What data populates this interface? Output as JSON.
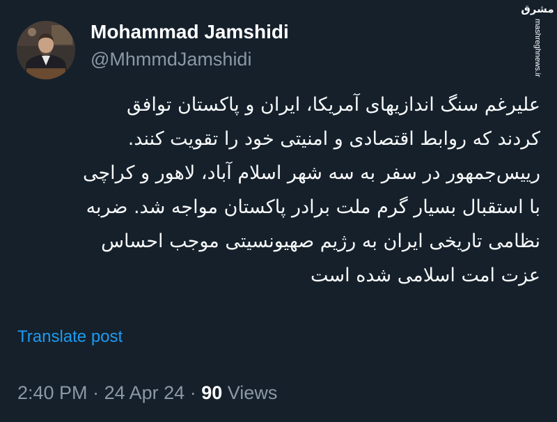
{
  "author": {
    "display_name": "Mohammad Jamshidi",
    "handle": "@MhmmdJamshidi",
    "avatar_icon": "profile-photo"
  },
  "watermark": {
    "logo_text": "مشرق",
    "site": "mashreghnews.ir"
  },
  "tweet": {
    "lines": [
      "علیرغم سنگ اندازیهای آمریکا، ایران و پاکستان توافق",
      "کردند که روابط اقتصادی و امنیتی خود را تقویت کنند.",
      "رییس‌جمهور در سفر به سه شهر اسلام آباد، لاهور و کراچی",
      "با استقبال بسیار گرم ملت برادر پاکستان مواجه شد. ضربه",
      "نظامی تاریخی ایران به رژیم صهیونسیتی موجب احساس",
      "عزت امت اسلامی شده است"
    ],
    "translate_label": "Translate post"
  },
  "meta": {
    "time": "2:40 PM",
    "separator": "·",
    "date": "24 Apr 24",
    "views_count": "90",
    "views_label": "Views"
  },
  "colors": {
    "background": "#15202b",
    "text": "#f7f9f9",
    "secondary": "#8b98a5",
    "link": "#1d9bf0"
  }
}
